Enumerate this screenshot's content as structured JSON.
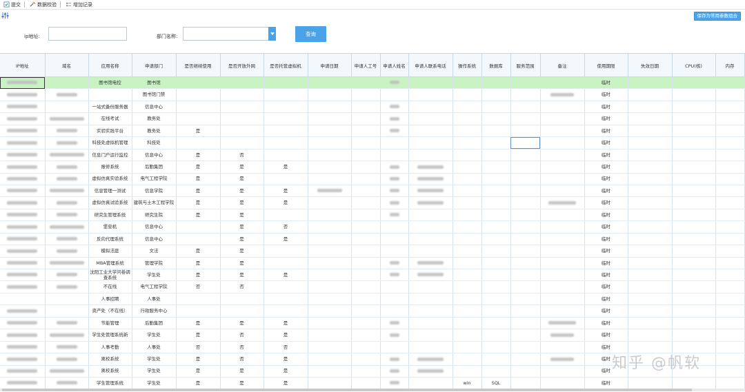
{
  "toolbar": {
    "submit_label": "提交",
    "validate_label": "数据校验",
    "audit_label": "增加记录"
  },
  "subbar": {
    "save_combo_label": "保存为常用参数组合"
  },
  "filters": {
    "ip_label": "ip地址:",
    "dept_label": "部门名称:",
    "query_label": "查询"
  },
  "columns": [
    "IP地址",
    "域名",
    "应用名称",
    "申请部门",
    "是否继续使用",
    "是否开放外网",
    "是否托管虚拟机",
    "申请日期",
    "申请人工号",
    "申请人姓名",
    "申请人联系电话",
    "操作系统",
    "数据库",
    "服务范围",
    "备注",
    "使用期限",
    "失效日期",
    "CPU(核)",
    "内存"
  ],
  "rows": [
    {
      "app": "图书馆电控",
      "dept": "图书馆",
      "cont": "",
      "ext": "",
      "vm": "",
      "os": "",
      "db": "",
      "term": "临时"
    },
    {
      "app": "",
      "dept": "图书馆门禁",
      "cont": "",
      "ext": "",
      "vm": "",
      "os": "",
      "db": "",
      "term": "临时"
    },
    {
      "app": "一站式备份服务器",
      "dept": "信息中心",
      "cont": "",
      "ext": "",
      "vm": "",
      "os": "",
      "db": "",
      "term": "临时"
    },
    {
      "app": "在线考试",
      "dept": "教务处",
      "cont": "",
      "ext": "",
      "vm": "",
      "os": "",
      "db": "",
      "term": "临时"
    },
    {
      "app": "实验实践平台",
      "dept": "教务处",
      "cont": "是",
      "ext": "",
      "vm": "",
      "os": "",
      "db": "",
      "term": "临时"
    },
    {
      "app": "科技处虚拟机管理",
      "dept": "科技处",
      "cont": "",
      "ext": "",
      "vm": "",
      "os": "",
      "db": "",
      "term": "临时"
    },
    {
      "app": "信息门户运行监控",
      "dept": "信息中心",
      "cont": "是",
      "ext": "否",
      "vm": "",
      "os": "",
      "db": "",
      "term": "临时"
    },
    {
      "app": "报修系统",
      "dept": "后勤集团",
      "cont": "是",
      "ext": "是",
      "vm": "是",
      "os": "",
      "db": "",
      "term": "临时"
    },
    {
      "app": "虚拟仿真实验系统",
      "dept": "电气工程学院",
      "cont": "是",
      "ext": "是",
      "vm": "",
      "os": "",
      "db": "",
      "term": "临时"
    },
    {
      "app": "信息管理一测试",
      "dept": "信息学院",
      "cont": "是",
      "ext": "是",
      "vm": "是",
      "os": "",
      "db": "",
      "term": "临时"
    },
    {
      "app": "虚拟仿真试验系统",
      "dept": "建筑与土木工程学院",
      "cont": "是",
      "ext": "是",
      "vm": "是",
      "os": "",
      "db": "",
      "term": "临时"
    },
    {
      "app": "研究生管理系统",
      "dept": "研究生院",
      "cont": "是",
      "ext": "是",
      "vm": "",
      "os": "",
      "db": "",
      "term": "临时"
    },
    {
      "app": "堡垒机",
      "dept": "信息中心",
      "cont": "",
      "ext": "是",
      "vm": "否",
      "os": "",
      "db": "",
      "term": "临时"
    },
    {
      "app": "反向代理系统",
      "dept": "信息中心",
      "cont": "",
      "ext": "是",
      "vm": "是",
      "os": "",
      "db": "",
      "term": "临时"
    },
    {
      "app": "模拟法庭",
      "dept": "文法",
      "cont": "是",
      "ext": "是",
      "vm": "",
      "os": "",
      "db": "",
      "term": "临时"
    },
    {
      "app": "MBA管理系统",
      "dept": "管理学院",
      "cont": "是",
      "ext": "是",
      "vm": "",
      "os": "",
      "db": "",
      "term": "临时"
    },
    {
      "app": "沈阳工业大学问卷调查系统",
      "dept": "学生处",
      "cont": "是",
      "ext": "是",
      "vm": "是",
      "os": "",
      "db": "",
      "term": "临时"
    },
    {
      "app": "不在线",
      "dept": "电气工程学院",
      "cont": "否",
      "ext": "否",
      "vm": "",
      "os": "",
      "db": "",
      "term": "临时"
    },
    {
      "app": "人事招聘",
      "dept": "人事处",
      "cont": "",
      "ext": "",
      "vm": "",
      "os": "",
      "db": "",
      "term": "临时"
    },
    {
      "app": "资产处（不在线）",
      "dept": "行政服务中心",
      "cont": "",
      "ext": "",
      "vm": "",
      "os": "",
      "db": "",
      "term": "临时"
    },
    {
      "app": "节能管理",
      "dept": "后勤集团",
      "cont": "是",
      "ext": "是",
      "vm": "是",
      "os": "",
      "db": "",
      "term": "临时"
    },
    {
      "app": "学生处管理系统新",
      "dept": "学生处",
      "cont": "是",
      "ext": "否",
      "vm": "是",
      "os": "",
      "db": "",
      "term": "临时"
    },
    {
      "app": "人事考勤",
      "dept": "人事处",
      "cont": "否",
      "ext": "否",
      "vm": "否",
      "os": "",
      "db": "",
      "term": "临时"
    },
    {
      "app": "离校系统",
      "dept": "学生处",
      "cont": "是",
      "ext": "否",
      "vm": "是",
      "os": "",
      "db": "",
      "term": "临时"
    },
    {
      "app": "离校系统",
      "dept": "学生处",
      "cont": "是",
      "ext": "是",
      "vm": "是",
      "os": "",
      "db": "",
      "term": "临时"
    },
    {
      "app": "学生管理系统",
      "dept": "学生处",
      "cont": "是",
      "ext": "是",
      "vm": "是",
      "os": "win",
      "db": "SQL",
      "term": "临时"
    }
  ],
  "watermark": "知乎 @帆软"
}
